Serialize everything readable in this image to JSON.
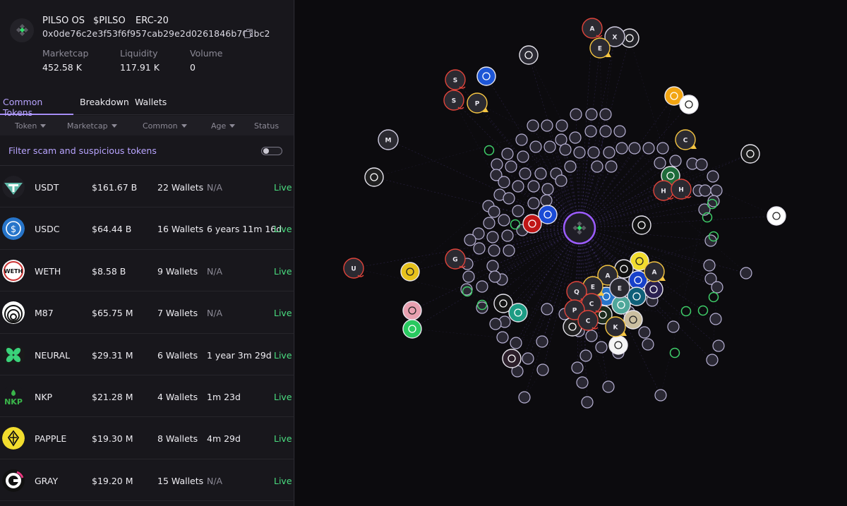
{
  "token": {
    "name": "PILSO OS",
    "symbol": "$PILSO",
    "standard": "ERC-20",
    "address": "0x0de76c2e3f53f6f957cab29e2d0261846b702bc2"
  },
  "stats": {
    "marketcap_label": "Marketcap",
    "marketcap_value": "452.58 K",
    "liquidity_label": "Liquidity",
    "liquidity_value": "117.91 K",
    "volume_label": "Volume",
    "volume_value": "0"
  },
  "tabs": [
    {
      "label": "Common Tokens",
      "active": true
    },
    {
      "label": "Breakdown",
      "active": false
    },
    {
      "label": "Wallets",
      "active": false
    }
  ],
  "columns": {
    "token": "Token",
    "marketcap": "Marketcap",
    "common": "Common",
    "age": "Age",
    "status": "Status"
  },
  "filter": {
    "label": "Filter scam and suspicious tokens",
    "enabled": false
  },
  "rows": [
    {
      "name": "USDT",
      "marketcap": "$161.67 B",
      "wallets": "22 Wallets",
      "age": "N/A",
      "status": "Live",
      "icon": "usdt-icon"
    },
    {
      "name": "USDC",
      "marketcap": "$64.44 B",
      "wallets": "16 Wallets",
      "age": "6 years 11m 16d",
      "status": "Live",
      "icon": "usdc-icon"
    },
    {
      "name": "WETH",
      "marketcap": "$8.58 B",
      "wallets": "9 Wallets",
      "age": "N/A",
      "status": "Live",
      "icon": "weth-icon"
    },
    {
      "name": "M87",
      "marketcap": "$65.75 M",
      "wallets": "7 Wallets",
      "age": "N/A",
      "status": "Live",
      "icon": "m87-icon"
    },
    {
      "name": "NEURAL",
      "marketcap": "$29.31 M",
      "wallets": "6 Wallets",
      "age": "1 year 3m 29d",
      "status": "Live",
      "icon": "neural-icon"
    },
    {
      "name": "NKP",
      "marketcap": "$21.28 M",
      "wallets": "4 Wallets",
      "age": "1m 23d",
      "status": "Live",
      "icon": "nkp-icon"
    },
    {
      "name": "PAPPLE",
      "marketcap": "$19.30 M",
      "wallets": "8 Wallets",
      "age": "4m 29d",
      "status": "Live",
      "icon": "papple-icon"
    },
    {
      "name": "GRAY",
      "marketcap": "$19.20 M",
      "wallets": "15 Wallets",
      "age": "N/A",
      "status": "Live",
      "icon": "gray-icon"
    }
  ],
  "colors": {
    "accent": "#a58df5",
    "live": "#4ade80",
    "warning": "#f5c542",
    "scam": "#e0443b"
  },
  "graph": {
    "center": "pilso-node",
    "badged_nodes": [
      {
        "label": "A",
        "kind": "scam"
      },
      {
        "label": "X",
        "kind": "neutral"
      },
      {
        "label": "E",
        "kind": "warning"
      },
      {
        "label": "S",
        "kind": "scam"
      },
      {
        "label": "S",
        "kind": "scam"
      },
      {
        "label": "P",
        "kind": "warning"
      },
      {
        "label": "M",
        "kind": "neutral"
      },
      {
        "label": "C",
        "kind": "warning"
      },
      {
        "label": "H",
        "kind": "scam"
      },
      {
        "label": "H",
        "kind": "scam"
      },
      {
        "label": "U",
        "kind": "scam"
      },
      {
        "label": "G",
        "kind": "scam"
      },
      {
        "label": "A",
        "kind": "warning"
      },
      {
        "label": "A",
        "kind": "warning"
      },
      {
        "label": "E",
        "kind": "warning"
      },
      {
        "label": "E",
        "kind": "neutral"
      },
      {
        "label": "Q",
        "kind": "scam"
      },
      {
        "label": "C",
        "kind": "scam"
      },
      {
        "label": "P",
        "kind": "scam"
      },
      {
        "label": "C",
        "kind": "scam"
      },
      {
        "label": "K",
        "kind": "warning"
      }
    ]
  }
}
